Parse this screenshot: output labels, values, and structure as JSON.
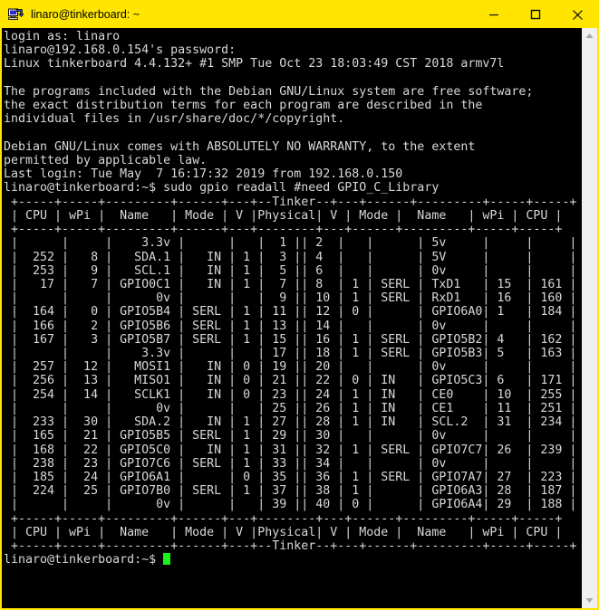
{
  "window": {
    "title": "linaro@tinkerboard: ~",
    "icon": "putty-icon",
    "titlebar_color": "#ffe500",
    "buttons": {
      "minimize": "minimize-button",
      "maximize": "maximize-button",
      "close": "close-button"
    }
  },
  "scrollbar": {
    "up_arrow": "scroll-up-arrow",
    "down_arrow": "scroll-down-arrow"
  },
  "terminal": {
    "background": "#000000",
    "foreground": "#d8d8d8",
    "cursor_color": "#18f218",
    "session": {
      "login_prompt": "login as: linaro",
      "password_prompt": "linaro@192.168.0.154's password:",
      "kernel_banner": "Linux tinkerboard 4.4.132+ #1 SMP Tue Oct 23 18:03:49 CST 2018 armv7l",
      "motd": [
        "The programs included with the Debian GNU/Linux system are free software;",
        "the exact distribution terms for each program are described in the",
        "individual files in /usr/share/doc/*/copyright.",
        "Debian GNU/Linux comes with ABSOLUTELY NO WARRANTY, to the extent",
        "permitted by applicable law."
      ],
      "last_login": "Last login: Tue May  7 16:17:32 2019 from 192.168.0.150",
      "prompt": "linaro@tinkerboard:~$",
      "command": "sudo gpio readall #need GPIO_C_Library",
      "final_prompt": "linaro@tinkerboard:~$"
    },
    "gpio_table": {
      "board_label": "Tinker",
      "headers": [
        "CPU",
        "wPi",
        "Name",
        "Mode",
        "V",
        "Physical",
        "V",
        "Mode",
        "Name",
        "wPi",
        "CPU"
      ],
      "rows": [
        {
          "cpu": "",
          "wpi": "",
          "name": "3.3v",
          "mode": "",
          "v": "",
          "phys_l": "1",
          "phys_r": "2",
          "v2": "",
          "mode2": "",
          "name2": "5v",
          "wpi2": "",
          "cpu2": ""
        },
        {
          "cpu": "252",
          "wpi": "8",
          "name": "SDA.1",
          "mode": "IN",
          "v": "1",
          "phys_l": "3",
          "phys_r": "4",
          "v2": "",
          "mode2": "",
          "name2": "5V",
          "wpi2": "",
          "cpu2": ""
        },
        {
          "cpu": "253",
          "wpi": "9",
          "name": "SCL.1",
          "mode": "IN",
          "v": "1",
          "phys_l": "5",
          "phys_r": "6",
          "v2": "",
          "mode2": "",
          "name2": "0v",
          "wpi2": "",
          "cpu2": ""
        },
        {
          "cpu": "17",
          "wpi": "7",
          "name": "GPIO0C1",
          "mode": "IN",
          "v": "1",
          "phys_l": "7",
          "phys_r": "8",
          "v2": "1",
          "mode2": "SERL",
          "name2": "TxD1",
          "wpi2": "15",
          "cpu2": "161"
        },
        {
          "cpu": "",
          "wpi": "",
          "name": "0v",
          "mode": "",
          "v": "",
          "phys_l": "9",
          "phys_r": "10",
          "v2": "1",
          "mode2": "SERL",
          "name2": "RxD1",
          "wpi2": "16",
          "cpu2": "160"
        },
        {
          "cpu": "164",
          "wpi": "0",
          "name": "GPIO5B4",
          "mode": "SERL",
          "v": "1",
          "phys_l": "11",
          "phys_r": "12",
          "v2": "0",
          "mode2": "",
          "name2": "GPIO6A0",
          "wpi2": "1",
          "cpu2": "184"
        },
        {
          "cpu": "166",
          "wpi": "2",
          "name": "GPIO5B6",
          "mode": "SERL",
          "v": "1",
          "phys_l": "13",
          "phys_r": "14",
          "v2": "",
          "mode2": "",
          "name2": "0v",
          "wpi2": "",
          "cpu2": ""
        },
        {
          "cpu": "167",
          "wpi": "3",
          "name": "GPIO5B7",
          "mode": "SERL",
          "v": "1",
          "phys_l": "15",
          "phys_r": "16",
          "v2": "1",
          "mode2": "SERL",
          "name2": "GPIO5B2",
          "wpi2": "4",
          "cpu2": "162"
        },
        {
          "cpu": "",
          "wpi": "",
          "name": "3.3v",
          "mode": "",
          "v": "",
          "phys_l": "17",
          "phys_r": "18",
          "v2": "1",
          "mode2": "SERL",
          "name2": "GPIO5B3",
          "wpi2": "5",
          "cpu2": "163"
        },
        {
          "cpu": "257",
          "wpi": "12",
          "name": "MOSI1",
          "mode": "IN",
          "v": "0",
          "phys_l": "19",
          "phys_r": "20",
          "v2": "",
          "mode2": "",
          "name2": "0v",
          "wpi2": "",
          "cpu2": ""
        },
        {
          "cpu": "256",
          "wpi": "13",
          "name": "MISO1",
          "mode": "IN",
          "v": "0",
          "phys_l": "21",
          "phys_r": "22",
          "v2": "0",
          "mode2": "IN",
          "name2": "GPIO5C3",
          "wpi2": "6",
          "cpu2": "171"
        },
        {
          "cpu": "254",
          "wpi": "14",
          "name": "SCLK1",
          "mode": "IN",
          "v": "0",
          "phys_l": "23",
          "phys_r": "24",
          "v2": "1",
          "mode2": "IN",
          "name2": "CE0",
          "wpi2": "10",
          "cpu2": "255"
        },
        {
          "cpu": "",
          "wpi": "",
          "name": "0v",
          "mode": "",
          "v": "",
          "phys_l": "25",
          "phys_r": "26",
          "v2": "1",
          "mode2": "IN",
          "name2": "CE1",
          "wpi2": "11",
          "cpu2": "251"
        },
        {
          "cpu": "233",
          "wpi": "30",
          "name": "SDA.2",
          "mode": "IN",
          "v": "1",
          "phys_l": "27",
          "phys_r": "28",
          "v2": "1",
          "mode2": "IN",
          "name2": "SCL.2",
          "wpi2": "31",
          "cpu2": "234"
        },
        {
          "cpu": "165",
          "wpi": "21",
          "name": "GPIO5B5",
          "mode": "SERL",
          "v": "1",
          "phys_l": "29",
          "phys_r": "30",
          "v2": "",
          "mode2": "",
          "name2": "0v",
          "wpi2": "",
          "cpu2": ""
        },
        {
          "cpu": "168",
          "wpi": "22",
          "name": "GPIO5C0",
          "mode": "IN",
          "v": "1",
          "phys_l": "31",
          "phys_r": "32",
          "v2": "1",
          "mode2": "SERL",
          "name2": "GPIO7C7",
          "wpi2": "26",
          "cpu2": "239"
        },
        {
          "cpu": "238",
          "wpi": "23",
          "name": "GPIO7C6",
          "mode": "SERL",
          "v": "1",
          "phys_l": "33",
          "phys_r": "34",
          "v2": "",
          "mode2": "",
          "name2": "0v",
          "wpi2": "",
          "cpu2": ""
        },
        {
          "cpu": "185",
          "wpi": "24",
          "name": "GPIO6A1",
          "mode": "",
          "v": "0",
          "phys_l": "35",
          "phys_r": "36",
          "v2": "1",
          "mode2": "SERL",
          "name2": "GPIO7A7",
          "wpi2": "27",
          "cpu2": "223"
        },
        {
          "cpu": "224",
          "wpi": "25",
          "name": "GPIO7B0",
          "mode": "SERL",
          "v": "1",
          "phys_l": "37",
          "phys_r": "38",
          "v2": "1",
          "mode2": "",
          "name2": "GPIO6A3",
          "wpi2": "28",
          "cpu2": "187"
        },
        {
          "cpu": "",
          "wpi": "",
          "name": "0v",
          "mode": "",
          "v": "",
          "phys_l": "39",
          "phys_r": "40",
          "v2": "0",
          "mode2": "",
          "name2": "GPIO6A4",
          "wpi2": "29",
          "cpu2": "188"
        }
      ]
    }
  }
}
